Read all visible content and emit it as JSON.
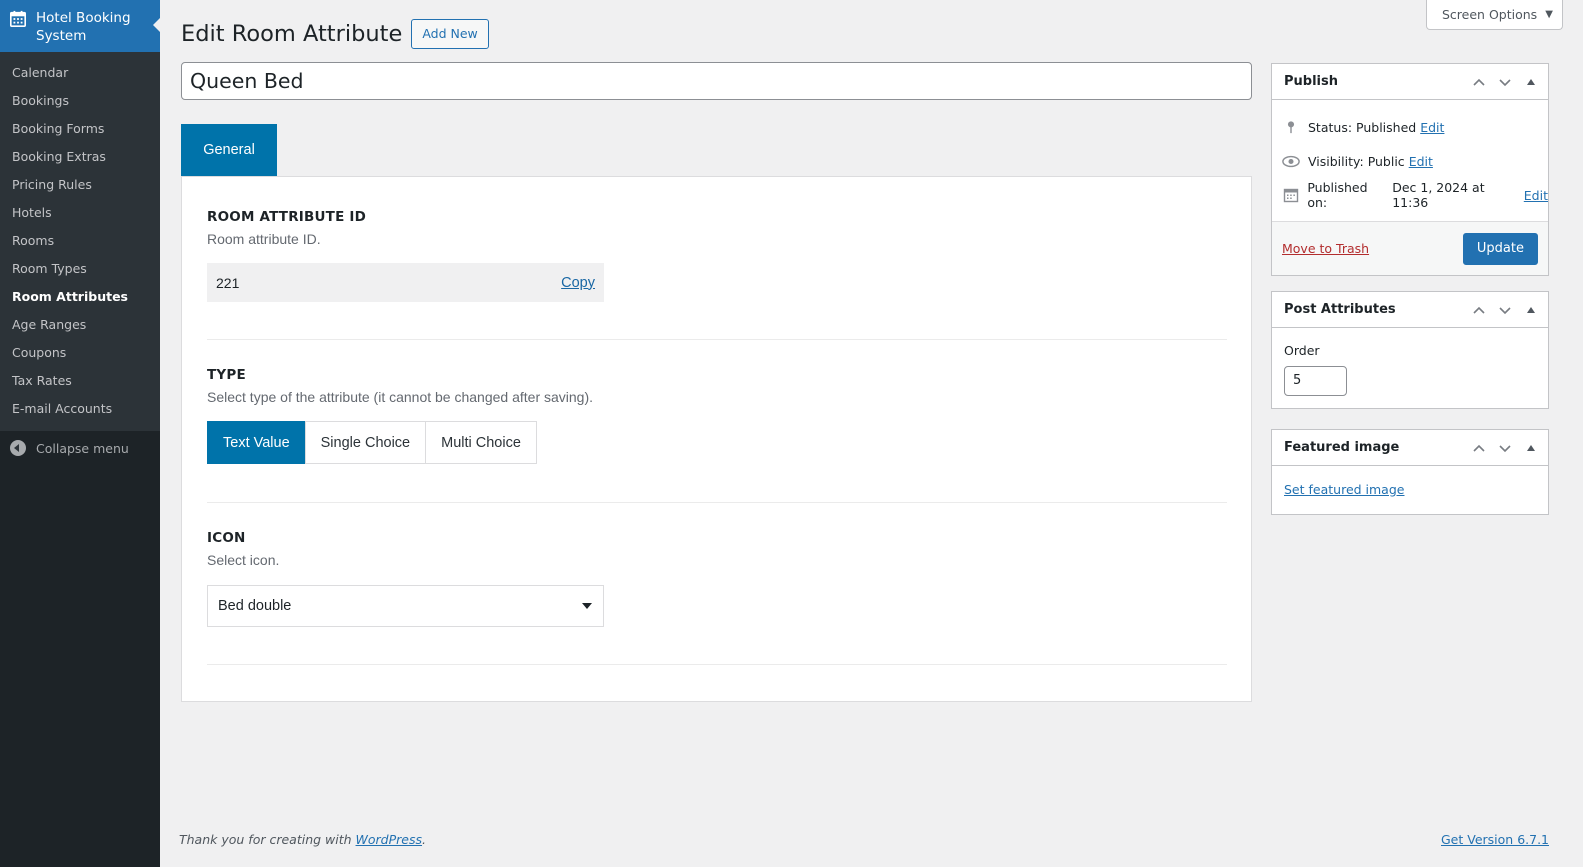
{
  "sidebar": {
    "menu_title": "Hotel Booking System",
    "items": [
      {
        "label": "Calendar"
      },
      {
        "label": "Bookings"
      },
      {
        "label": "Booking Forms"
      },
      {
        "label": "Booking Extras"
      },
      {
        "label": "Pricing Rules"
      },
      {
        "label": "Hotels"
      },
      {
        "label": "Rooms"
      },
      {
        "label": "Room Types"
      },
      {
        "label": "Room Attributes",
        "current": true
      },
      {
        "label": "Age Ranges"
      },
      {
        "label": "Coupons"
      },
      {
        "label": "Tax Rates"
      },
      {
        "label": "E-mail Accounts"
      }
    ],
    "collapse_label": "Collapse menu"
  },
  "screen_options": {
    "label": "Screen Options"
  },
  "header": {
    "title": "Edit Room Attribute",
    "add_new_label": "Add New"
  },
  "post_title": {
    "value": "Queen Bed"
  },
  "tabs": [
    {
      "label": "General",
      "active": true
    }
  ],
  "fields": {
    "id": {
      "label": "ROOM ATTRIBUTE ID",
      "description": "Room attribute ID.",
      "value": "221",
      "copy_label": "Copy"
    },
    "type": {
      "label": "TYPE",
      "description": "Select type of the attribute (it cannot be changed after saving).",
      "options": [
        "Text Value",
        "Single Choice",
        "Multi Choice"
      ],
      "selected": "Text Value"
    },
    "icon": {
      "label": "ICON",
      "description": "Select icon.",
      "selected": "Bed double"
    }
  },
  "publish_box": {
    "title": "Publish",
    "status_label": "Status:",
    "status_value": "Published",
    "visibility_label": "Visibility:",
    "visibility_value": "Public",
    "published_label": "Published on:",
    "published_value": "Dec 1, 2024 at 11:36",
    "edit_label": "Edit",
    "trash_label": "Move to Trash",
    "update_label": "Update"
  },
  "attributes_box": {
    "title": "Post Attributes",
    "order_label": "Order",
    "order_value": "5"
  },
  "featured_box": {
    "title": "Featured image",
    "link_label": "Set featured image"
  },
  "footer": {
    "thanks_text": "Thank you for creating with",
    "wp_link": "WordPress",
    "period": ".",
    "version_label": "Get Version 6.7.1"
  },
  "colors": {
    "accent": "#2271b1",
    "tab_active": "#0073aa",
    "sidebar_bg": "#1d2327",
    "submenu_bg": "#2c3338",
    "danger": "#b32d2e"
  },
  "icons": [
    "calendar-icon",
    "collapse-arrow-icon",
    "pin-icon",
    "eye-icon",
    "calendar-small-icon",
    "chevron-up-icon",
    "chevron-down-icon",
    "toggle-arrow-icon",
    "dropdown-caret-icon"
  ]
}
